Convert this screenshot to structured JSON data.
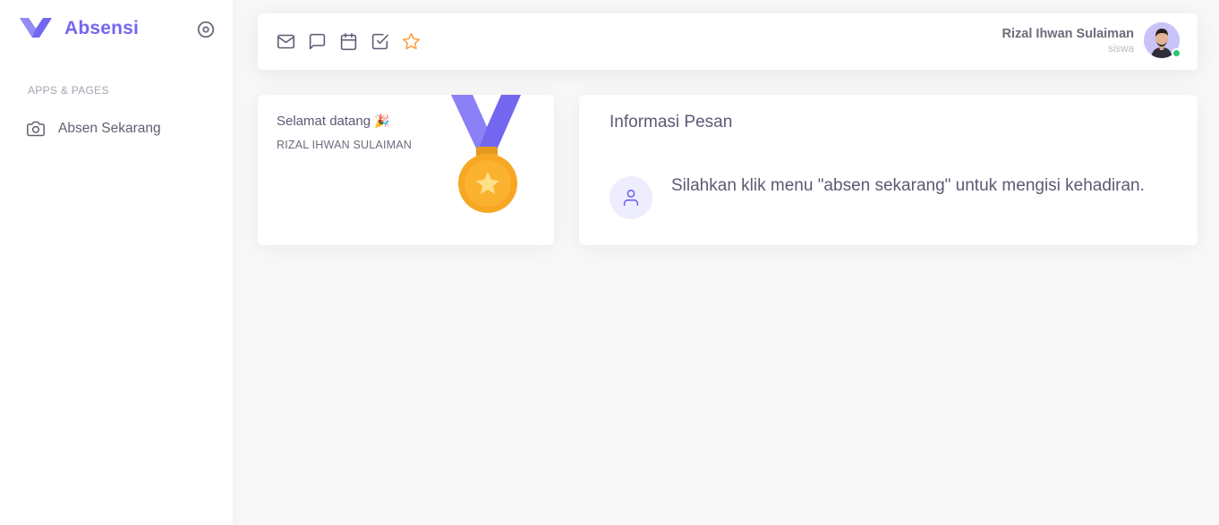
{
  "brand": {
    "name": "Absensi",
    "color": "#7367f0"
  },
  "sidebar": {
    "section_title": "APPS & PAGES",
    "items": [
      {
        "label": "Absen Sekarang",
        "icon": "camera-icon"
      }
    ]
  },
  "navbar": {
    "icons": [
      "mail-icon",
      "chat-icon",
      "calendar-icon",
      "check-square-icon",
      "star-icon"
    ],
    "user": {
      "name": "Rizal Ihwan Sulaiman",
      "role": "siswa",
      "status": "online"
    }
  },
  "welcome_card": {
    "title": "Selamat datang",
    "emoji": "🎉",
    "name": "RIZAL IHWAN SULAIMAN"
  },
  "info_card": {
    "title": "Informasi Pesan",
    "message": "Silahkan klik menu \"absen sekarang\" untuk mengisi kehadiran."
  },
  "colors": {
    "accent": "#7367f0",
    "online": "#28c76f",
    "star": "#ff9f43",
    "medal": "#fbb32f"
  }
}
